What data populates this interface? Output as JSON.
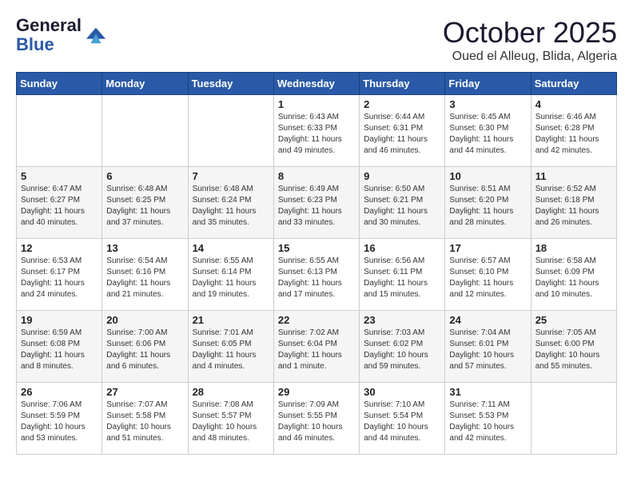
{
  "header": {
    "logo_line1": "General",
    "logo_line2": "Blue",
    "month_title": "October 2025",
    "subtitle": "Oued el Alleug, Blida, Algeria"
  },
  "weekdays": [
    "Sunday",
    "Monday",
    "Tuesday",
    "Wednesday",
    "Thursday",
    "Friday",
    "Saturday"
  ],
  "weeks": [
    [
      {
        "day": "",
        "info": ""
      },
      {
        "day": "",
        "info": ""
      },
      {
        "day": "",
        "info": ""
      },
      {
        "day": "1",
        "info": "Sunrise: 6:43 AM\nSunset: 6:33 PM\nDaylight: 11 hours\nand 49 minutes."
      },
      {
        "day": "2",
        "info": "Sunrise: 6:44 AM\nSunset: 6:31 PM\nDaylight: 11 hours\nand 46 minutes."
      },
      {
        "day": "3",
        "info": "Sunrise: 6:45 AM\nSunset: 6:30 PM\nDaylight: 11 hours\nand 44 minutes."
      },
      {
        "day": "4",
        "info": "Sunrise: 6:46 AM\nSunset: 6:28 PM\nDaylight: 11 hours\nand 42 minutes."
      }
    ],
    [
      {
        "day": "5",
        "info": "Sunrise: 6:47 AM\nSunset: 6:27 PM\nDaylight: 11 hours\nand 40 minutes."
      },
      {
        "day": "6",
        "info": "Sunrise: 6:48 AM\nSunset: 6:25 PM\nDaylight: 11 hours\nand 37 minutes."
      },
      {
        "day": "7",
        "info": "Sunrise: 6:48 AM\nSunset: 6:24 PM\nDaylight: 11 hours\nand 35 minutes."
      },
      {
        "day": "8",
        "info": "Sunrise: 6:49 AM\nSunset: 6:23 PM\nDaylight: 11 hours\nand 33 minutes."
      },
      {
        "day": "9",
        "info": "Sunrise: 6:50 AM\nSunset: 6:21 PM\nDaylight: 11 hours\nand 30 minutes."
      },
      {
        "day": "10",
        "info": "Sunrise: 6:51 AM\nSunset: 6:20 PM\nDaylight: 11 hours\nand 28 minutes."
      },
      {
        "day": "11",
        "info": "Sunrise: 6:52 AM\nSunset: 6:18 PM\nDaylight: 11 hours\nand 26 minutes."
      }
    ],
    [
      {
        "day": "12",
        "info": "Sunrise: 6:53 AM\nSunset: 6:17 PM\nDaylight: 11 hours\nand 24 minutes."
      },
      {
        "day": "13",
        "info": "Sunrise: 6:54 AM\nSunset: 6:16 PM\nDaylight: 11 hours\nand 21 minutes."
      },
      {
        "day": "14",
        "info": "Sunrise: 6:55 AM\nSunset: 6:14 PM\nDaylight: 11 hours\nand 19 minutes."
      },
      {
        "day": "15",
        "info": "Sunrise: 6:55 AM\nSunset: 6:13 PM\nDaylight: 11 hours\nand 17 minutes."
      },
      {
        "day": "16",
        "info": "Sunrise: 6:56 AM\nSunset: 6:11 PM\nDaylight: 11 hours\nand 15 minutes."
      },
      {
        "day": "17",
        "info": "Sunrise: 6:57 AM\nSunset: 6:10 PM\nDaylight: 11 hours\nand 12 minutes."
      },
      {
        "day": "18",
        "info": "Sunrise: 6:58 AM\nSunset: 6:09 PM\nDaylight: 11 hours\nand 10 minutes."
      }
    ],
    [
      {
        "day": "19",
        "info": "Sunrise: 6:59 AM\nSunset: 6:08 PM\nDaylight: 11 hours\nand 8 minutes."
      },
      {
        "day": "20",
        "info": "Sunrise: 7:00 AM\nSunset: 6:06 PM\nDaylight: 11 hours\nand 6 minutes."
      },
      {
        "day": "21",
        "info": "Sunrise: 7:01 AM\nSunset: 6:05 PM\nDaylight: 11 hours\nand 4 minutes."
      },
      {
        "day": "22",
        "info": "Sunrise: 7:02 AM\nSunset: 6:04 PM\nDaylight: 11 hours\nand 1 minute."
      },
      {
        "day": "23",
        "info": "Sunrise: 7:03 AM\nSunset: 6:02 PM\nDaylight: 10 hours\nand 59 minutes."
      },
      {
        "day": "24",
        "info": "Sunrise: 7:04 AM\nSunset: 6:01 PM\nDaylight: 10 hours\nand 57 minutes."
      },
      {
        "day": "25",
        "info": "Sunrise: 7:05 AM\nSunset: 6:00 PM\nDaylight: 10 hours\nand 55 minutes."
      }
    ],
    [
      {
        "day": "26",
        "info": "Sunrise: 7:06 AM\nSunset: 5:59 PM\nDaylight: 10 hours\nand 53 minutes."
      },
      {
        "day": "27",
        "info": "Sunrise: 7:07 AM\nSunset: 5:58 PM\nDaylight: 10 hours\nand 51 minutes."
      },
      {
        "day": "28",
        "info": "Sunrise: 7:08 AM\nSunset: 5:57 PM\nDaylight: 10 hours\nand 48 minutes."
      },
      {
        "day": "29",
        "info": "Sunrise: 7:09 AM\nSunset: 5:55 PM\nDaylight: 10 hours\nand 46 minutes."
      },
      {
        "day": "30",
        "info": "Sunrise: 7:10 AM\nSunset: 5:54 PM\nDaylight: 10 hours\nand 44 minutes."
      },
      {
        "day": "31",
        "info": "Sunrise: 7:11 AM\nSunset: 5:53 PM\nDaylight: 10 hours\nand 42 minutes."
      },
      {
        "day": "",
        "info": ""
      }
    ]
  ]
}
